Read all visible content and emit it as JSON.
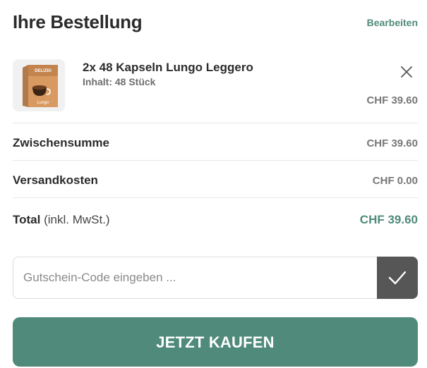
{
  "order": {
    "title": "Ihre Bestellung",
    "edit_label": "Bearbeiten"
  },
  "item": {
    "name": "2x 48 Kapseln Lungo Leggero",
    "content": "Inhalt: 48 Stück",
    "price": "CHF 39.60",
    "package_brand": "DELIZIO",
    "package_label": "Lungo"
  },
  "summary": {
    "subtotal_label": "Zwischensumme",
    "subtotal_value": "CHF 39.60",
    "shipping_label": "Versandkosten",
    "shipping_value": "CHF 0.00",
    "total_label": "Total",
    "total_note": "(inkl. MwSt.)",
    "total_value": "CHF 39.60"
  },
  "coupon": {
    "placeholder": "Gutschein-Code eingeben ...",
    "value": ""
  },
  "checkout": {
    "button_label": "JETZT KAUFEN"
  },
  "colors": {
    "accent": "#4f8a7a",
    "confirm_button": "#565656",
    "text": "#2b2b2b",
    "muted": "#777777"
  }
}
